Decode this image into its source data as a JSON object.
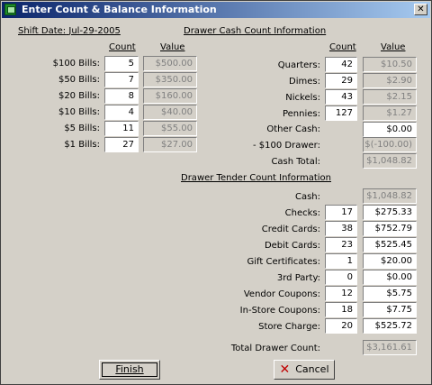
{
  "window": {
    "title": "Enter Count & Balance Information",
    "close_label": "✕"
  },
  "shift": {
    "label": "Shift Date:",
    "date": "Jul-29-2005"
  },
  "bills": {
    "headers": {
      "count": "Count",
      "value": "Value"
    },
    "rows": [
      {
        "label": "$100 Bills:",
        "count": "5",
        "value": "$500.00"
      },
      {
        "label": "$50 Bills:",
        "count": "7",
        "value": "$350.00"
      },
      {
        "label": "$20 Bills:",
        "count": "8",
        "value": "$160.00"
      },
      {
        "label": "$10 Bills:",
        "count": "4",
        "value": "$40.00"
      },
      {
        "label": "$5 Bills:",
        "count": "11",
        "value": "$55.00"
      },
      {
        "label": "$1 Bills:",
        "count": "27",
        "value": "$27.00"
      }
    ]
  },
  "cash": {
    "section_title": "Drawer Cash Count Information",
    "headers": {
      "count": "Count",
      "value": "Value"
    },
    "rows": [
      {
        "label": "Quarters:",
        "count": "42",
        "value": "$10.50"
      },
      {
        "label": "Dimes:",
        "count": "29",
        "value": "$2.90"
      },
      {
        "label": "Nickels:",
        "count": "43",
        "value": "$2.15"
      },
      {
        "label": "Pennies:",
        "count": "127",
        "value": "$1.27"
      }
    ],
    "other_cash": {
      "label": "Other Cash:",
      "value": "$0.00"
    },
    "drawer_100": {
      "label": "- $100 Drawer:",
      "value": "$(-100.00)"
    },
    "total": {
      "label": "Cash Total:",
      "value": "$1,048.82"
    }
  },
  "tender": {
    "section_title": "Drawer Tender Count Information",
    "cash": {
      "label": "Cash:",
      "value": "$1,048.82"
    },
    "rows": [
      {
        "label": "Checks:",
        "count": "17",
        "value": "$275.33"
      },
      {
        "label": "Credit Cards:",
        "count": "38",
        "value": "$752.79"
      },
      {
        "label": "Debit Cards:",
        "count": "23",
        "value": "$525.45"
      },
      {
        "label": "Gift Certificates:",
        "count": "1",
        "value": "$20.00"
      },
      {
        "label": "3rd Party:",
        "count": "0",
        "value": "$0.00"
      },
      {
        "label": "Vendor Coupons:",
        "count": "12",
        "value": "$5.75"
      },
      {
        "label": "In-Store Coupons:",
        "count": "18",
        "value": "$7.75"
      },
      {
        "label": "Store Charge:",
        "count": "20",
        "value": "$525.72"
      }
    ],
    "total": {
      "label": "Total Drawer Count:",
      "value": "$3,161.61"
    }
  },
  "buttons": {
    "finish": "Finish",
    "cancel": "Cancel"
  }
}
